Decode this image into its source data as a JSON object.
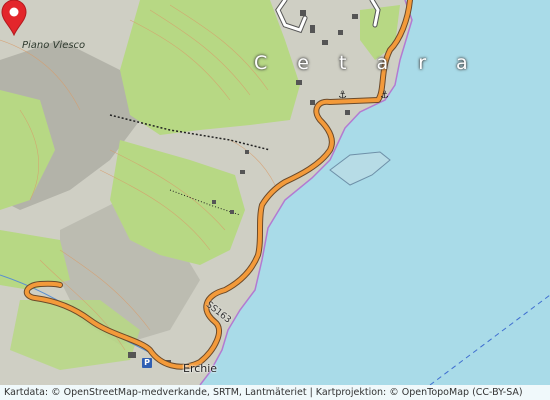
{
  "map": {
    "place_labels": {
      "town": "C e t a r a",
      "locality": "Piano Viesco",
      "village": "Erchie"
    },
    "road_label": "SS163",
    "parking_symbol": "P",
    "marker": {
      "name": "location-pin",
      "color": "#e3262b"
    },
    "poi_icons": [
      "anchor-icon",
      "anchor-icon"
    ],
    "colors": {
      "sea": "#a9dbe8",
      "forest": "#b7d884",
      "terrain": "#cfcfc4",
      "road_main": "#f39a3a",
      "road_casing": "#6b4a2a",
      "contour": "#d89c6a"
    },
    "attribution": "Kartdata: © OpenStreetMap-medverkande, SRTM, Lantmäteriet | Kartprojektion: © OpenTopoMap (CC-BY-SA)"
  }
}
